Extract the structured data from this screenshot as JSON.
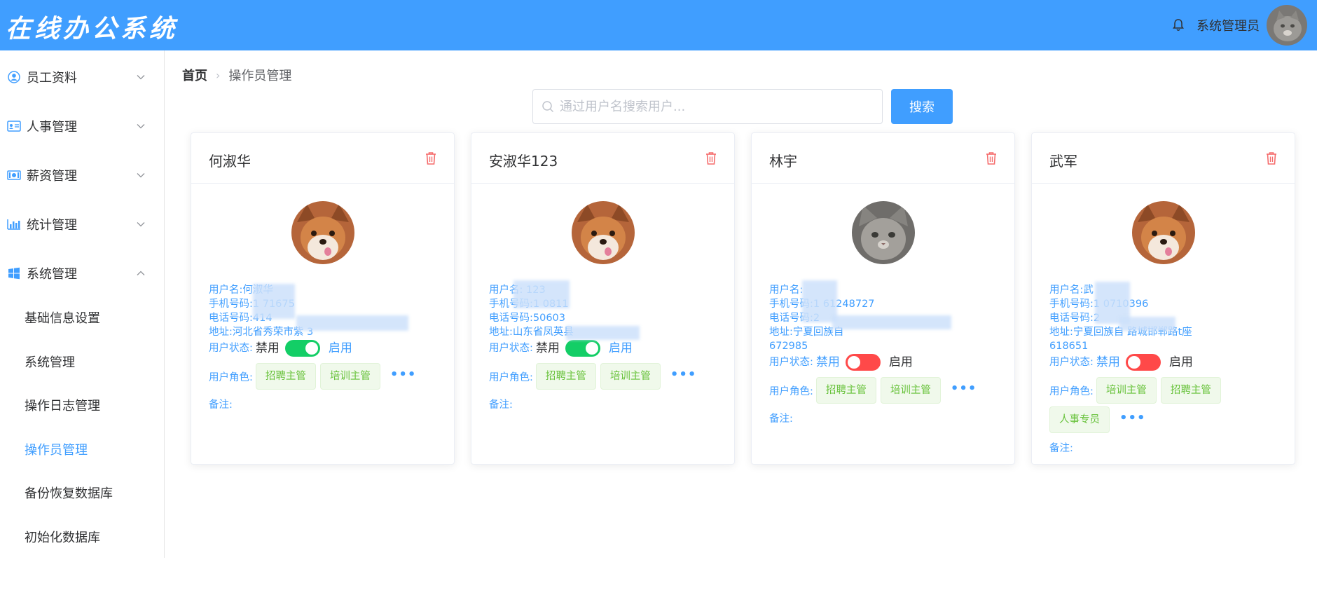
{
  "header": {
    "app_title": "在线办公系统",
    "user_name": "系统管理员"
  },
  "sidebar": {
    "menus": [
      {
        "label": "员工资料",
        "icon": "user-circle-icon"
      },
      {
        "label": "人事管理",
        "icon": "id-card-icon"
      },
      {
        "label": "薪资管理",
        "icon": "money-icon"
      },
      {
        "label": "统计管理",
        "icon": "bar-chart-icon"
      },
      {
        "label": "系统管理",
        "icon": "windows-icon"
      }
    ],
    "sub_items": [
      {
        "label": "基础信息设置"
      },
      {
        "label": "系统管理"
      },
      {
        "label": "操作日志管理"
      },
      {
        "label": "操作员管理"
      },
      {
        "label": "备份恢复数据库"
      },
      {
        "label": "初始化数据库"
      }
    ]
  },
  "breadcrumb": {
    "home": "首页",
    "current": "操作员管理"
  },
  "search": {
    "placeholder": "通过用户名搜索用户...",
    "button_label": "搜索"
  },
  "labels": {
    "status": "用户状态:",
    "disabled": "禁用",
    "enabled": "启用",
    "roles": "用户角色:",
    "remark": "备注:"
  },
  "colors": {
    "primary": "#409eff",
    "switch_on": "#13ce66",
    "switch_off": "#ff4949",
    "danger": "#f56c6c",
    "tag_text": "#67c23a"
  },
  "cards": [
    {
      "name": "何淑华",
      "avatar": "shiba-dog",
      "username_line": "用户名:何淑华",
      "mobile_line": "手机号码:1    71675",
      "phone_line": "电话号码:414",
      "address_line": "地址:河北省秀荣市紫        3",
      "zip_line": "",
      "enabled": true,
      "roles": [
        "招聘主管",
        "培训主管"
      ],
      "remark": ""
    },
    {
      "name": "安淑华123",
      "avatar": "shiba-dog",
      "username_line": "用户名:     123",
      "mobile_line": "手机号码:1     0811",
      "phone_line": "电话号码:50603",
      "address_line": "地址:山东省凤英县",
      "zip_line": "",
      "enabled": true,
      "roles": [
        "招聘主管",
        "培训主管"
      ],
      "remark": ""
    },
    {
      "name": "林宇",
      "avatar": "gray-cat",
      "username_line": "用户名:",
      "mobile_line": "手机号码:1   61248727",
      "phone_line": "电话号码:2",
      "address_line": "地址:宁夏回族自",
      "zip_line": "672985",
      "enabled": false,
      "roles": [
        "招聘主管",
        "培训主管"
      ],
      "remark": ""
    },
    {
      "name": "武军",
      "avatar": "shiba-dog",
      "username_line": "用户名:武",
      "mobile_line": "手机号码:1  0710396",
      "phone_line": "电话号码:2",
      "address_line": "地址:宁夏回族自        路城邯郸路t座",
      "zip_line": "618651",
      "enabled": false,
      "roles": [
        "培训主管",
        "招聘主管",
        "人事专员"
      ],
      "remark": ""
    }
  ]
}
